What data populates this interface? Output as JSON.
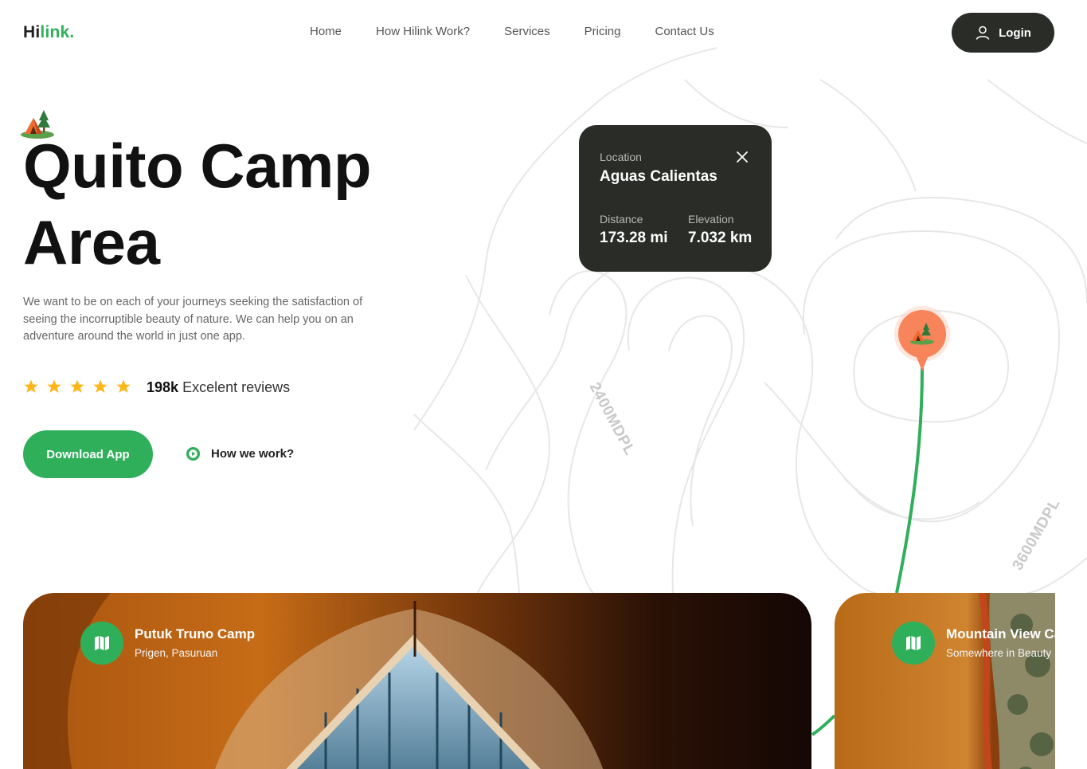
{
  "header": {
    "logo_part1": "Hi",
    "logo_part2": "link.",
    "nav": [
      "Home",
      "How Hilink Work?",
      "Services",
      "Pricing",
      "Contact Us"
    ],
    "login_label": "Login",
    "login_icon": "user-icon"
  },
  "hero": {
    "title": "Quito Camp Area",
    "description": "We want to be on each of your journeys seeking the satisfaction of seeing the incorruptible beauty of nature. We can help you on an adventure around the world in just one app.",
    "rating_stars": 5,
    "reviews_count": "198k",
    "reviews_label": "Excelent reviews",
    "download_label": "Download App",
    "how_we_work_label": "How we work?"
  },
  "location_card": {
    "location_label": "Location",
    "location_value": "Aguas Calientas",
    "distance_label": "Distance",
    "distance_value": "173.28 mi",
    "elevation_label": "Elevation",
    "elevation_value": "7.032 km"
  },
  "map": {
    "contour_label_1": "2400MDPL",
    "contour_label_2": "3600MDPL"
  },
  "camps": [
    {
      "title": "Putuk Truno Camp",
      "subtitle": "Prigen, Pasuruan",
      "icon": "map-icon"
    },
    {
      "title": "Mountain View Camp",
      "subtitle": "Somewhere in Beauty",
      "icon": "map-icon"
    }
  ],
  "colors": {
    "brand_green": "#30af5b",
    "dark": "#292c27",
    "star": "#fdb71c",
    "pin": "#f7845a"
  }
}
